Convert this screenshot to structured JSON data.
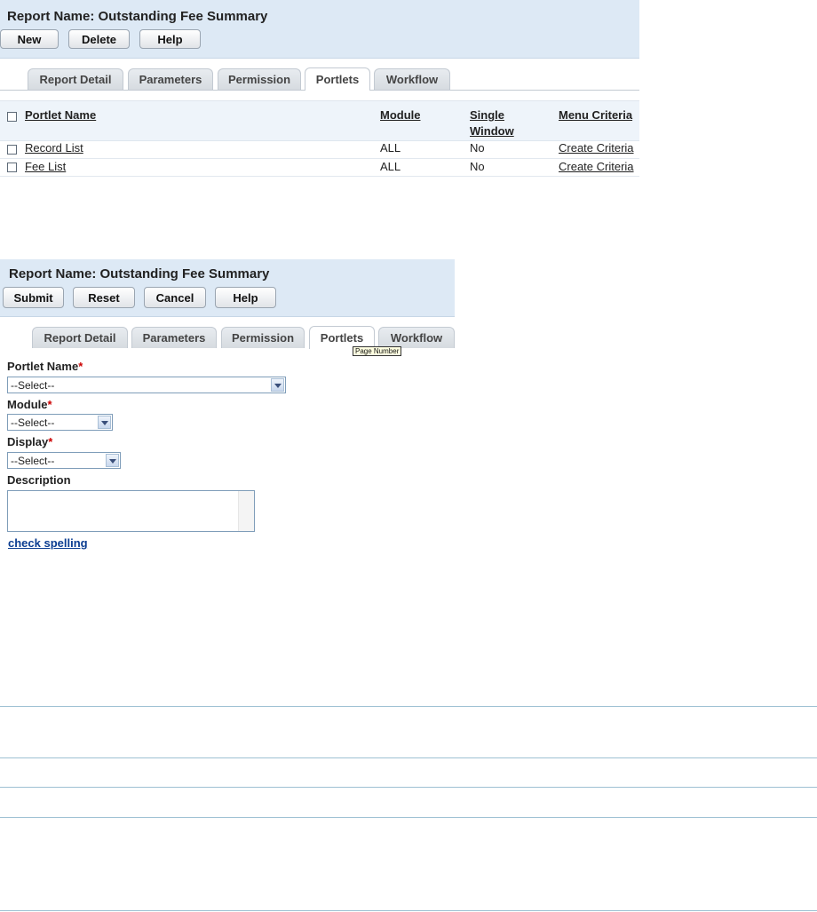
{
  "section1": {
    "report_name": "Report Name: Outstanding Fee Summary",
    "buttons": [
      "New",
      "Delete",
      "Help"
    ],
    "tabs": [
      "Report Detail",
      "Parameters",
      "Permission",
      "Portlets",
      "Workflow"
    ],
    "active_tab": "Portlets",
    "table": {
      "columns": [
        "Portlet Name",
        "Module",
        "Single",
        "Window",
        "Menu Criteria"
      ],
      "rows": [
        [
          "Record List",
          "ALL",
          "No",
          "Create Criteria"
        ],
        [
          "Fee List",
          "ALL",
          "No",
          "Create Criteria"
        ]
      ]
    }
  },
  "section2": {
    "report_name": "Report Name: Outstanding Fee Summary",
    "buttons": [
      "Submit",
      "Reset",
      "Cancel",
      "Help"
    ],
    "tabs": [
      "Report Detail",
      "Parameters",
      "Permission",
      "Portlets",
      "Workflow"
    ],
    "active_tab": "Portlets",
    "tooltip": "Page Number",
    "form": {
      "portlet_name_label": "Portlet Name",
      "portlet_name_value": "--Select--",
      "module_label": "Module",
      "module_value": "--Select--",
      "display_label": "Display",
      "display_value": "--Select--",
      "description_label": "Description",
      "required_mark": "*",
      "check_spelling": "check spelling"
    }
  },
  "colors": {
    "panel": "#dde9f5",
    "link": "#0b3d91",
    "required": "#cc0000",
    "rule": "#9ec1d3"
  }
}
